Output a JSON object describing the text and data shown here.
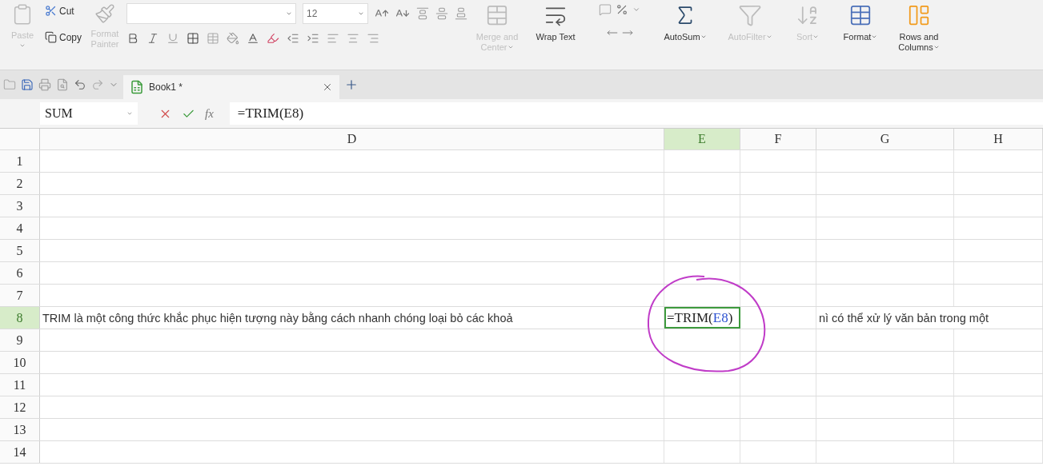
{
  "ribbon": {
    "paste": {
      "label": "Paste",
      "disabled": true
    },
    "cut": {
      "label": "Cut",
      "disabled": false
    },
    "copy": {
      "label": "Copy",
      "disabled": false
    },
    "format_painter": {
      "label": "Format Painter",
      "disabled": true
    },
    "font_size": "12",
    "buttons": [
      {
        "kind": "merge",
        "label": "Merge and Center",
        "disabled": true,
        "dropdown": true
      },
      {
        "kind": "wrap",
        "label": "Wrap Text",
        "disabled": false,
        "dropdown": false
      },
      {
        "kind": "number"
      },
      {
        "kind": "autosum",
        "label": "AutoSum",
        "disabled": false,
        "dropdown": true
      },
      {
        "kind": "filter",
        "label": "AutoFilter",
        "disabled": true,
        "dropdown": true
      },
      {
        "kind": "sort",
        "label": "Sort",
        "disabled": true,
        "dropdown": true
      },
      {
        "kind": "format",
        "label": "Format",
        "disabled": false,
        "dropdown": true
      },
      {
        "kind": "rowscols",
        "label": "Rows and Columns",
        "disabled": false,
        "dropdown": true
      }
    ]
  },
  "tabs": [
    {
      "label": "Book1 *",
      "selected": true
    }
  ],
  "formula_bar": {
    "name_box": "SUM",
    "fx": "fx",
    "formula": "=TRIM(E8)"
  },
  "columns": [
    {
      "label": "D",
      "selected": false
    },
    {
      "label": "E",
      "selected": true
    },
    {
      "label": "F",
      "selected": false
    },
    {
      "label": "G",
      "selected": false
    },
    {
      "label": "H",
      "selected": false
    }
  ],
  "rows": [
    {
      "label": "1",
      "selected": false
    },
    {
      "label": "2",
      "selected": false
    },
    {
      "label": "3",
      "selected": false
    },
    {
      "label": "4",
      "selected": false
    },
    {
      "label": "5",
      "selected": false
    },
    {
      "label": "6",
      "selected": false
    },
    {
      "label": "7",
      "selected": false
    },
    {
      "label": "8",
      "selected": true,
      "cells": [
        {
          "kind": "text",
          "text": "TRIM là một công thức khắc phục hiện tượng này bằng cách nhanh chóng loại bỏ các khoả"
        },
        {
          "kind": "formula",
          "selected": true,
          "parts": [
            {
              "kind": "plain",
              "text": "=TRIM("
            },
            {
              "kind": "reference",
              "text": "E8"
            },
            {
              "kind": "plain",
              "text": ")"
            }
          ]
        },
        {
          "kind": "empty"
        },
        {
          "kind": "text",
          "text": "nì có thể xử lý văn bản trong một"
        },
        {
          "kind": "empty"
        }
      ]
    },
    {
      "label": "9",
      "selected": false
    },
    {
      "label": "10",
      "selected": false
    },
    {
      "label": "11",
      "selected": false
    },
    {
      "label": "12",
      "selected": false
    },
    {
      "label": "13",
      "selected": false
    },
    {
      "label": "14",
      "selected": false
    }
  ],
  "annotation": {
    "kind": "circle"
  }
}
